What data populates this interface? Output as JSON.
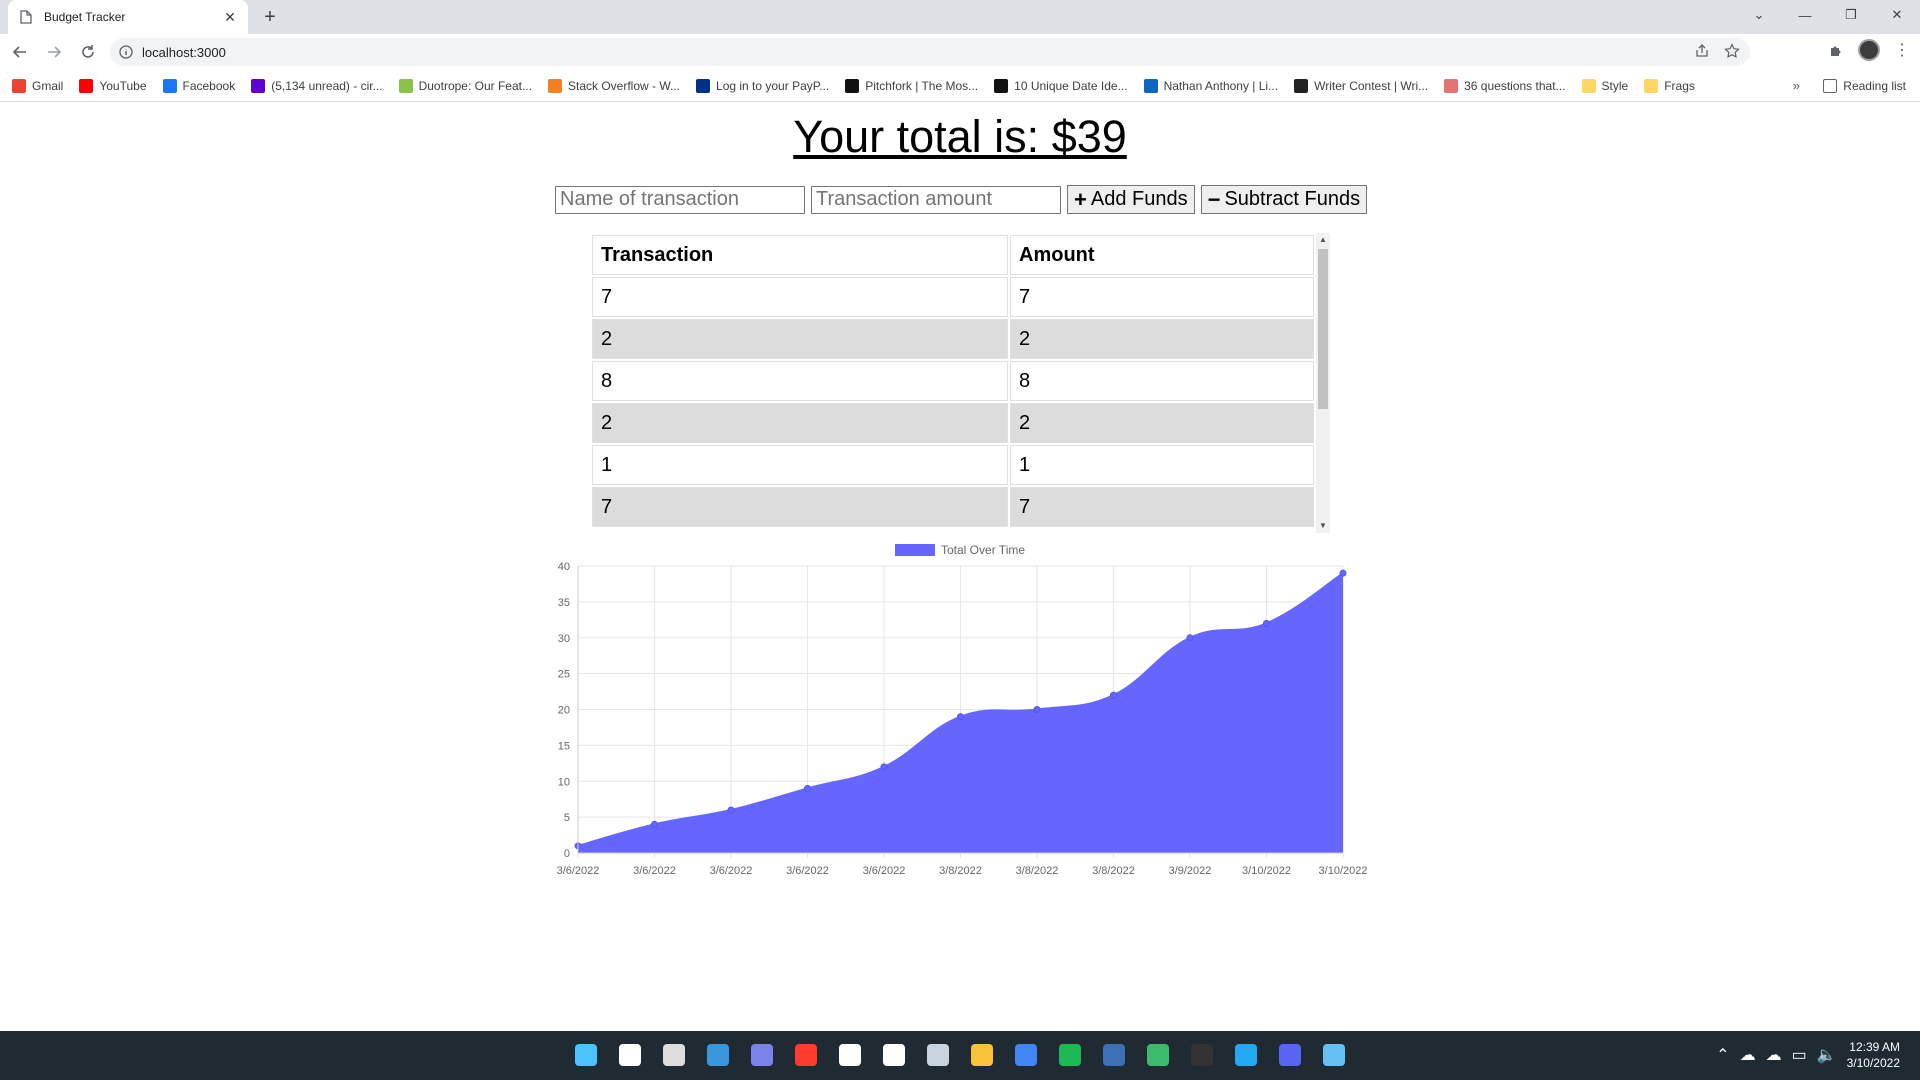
{
  "browser": {
    "tab_title": "Budget Tracker",
    "url": "localhost:3000",
    "bookmarks": [
      {
        "label": "Gmail",
        "color": "#ea4335"
      },
      {
        "label": "YouTube",
        "color": "#ff0000"
      },
      {
        "label": "Facebook",
        "color": "#1877f2"
      },
      {
        "label": "(5,134 unread) - cir...",
        "color": "#6001d2"
      },
      {
        "label": "Duotrope: Our Feat...",
        "color": "#8bc34a"
      },
      {
        "label": "Stack Overflow - W...",
        "color": "#f48024"
      },
      {
        "label": "Log in to your PayP...",
        "color": "#003087"
      },
      {
        "label": "Pitchfork | The Mos...",
        "color": "#111111"
      },
      {
        "label": "10 Unique Date Ide...",
        "color": "#111111"
      },
      {
        "label": "Nathan Anthony | Li...",
        "color": "#0a66c2"
      },
      {
        "label": "Writer Contest | Wri...",
        "color": "#222222"
      },
      {
        "label": "36 questions that...",
        "color": "#e57373"
      },
      {
        "label": "Style",
        "color": "#fdd663"
      },
      {
        "label": "Frags",
        "color": "#fdd663"
      }
    ],
    "more": "»",
    "reading_list": "Reading list"
  },
  "page": {
    "total_text": "Your total is: $39",
    "name_placeholder": "Name of transaction",
    "amount_placeholder": "Transaction amount",
    "add_label": "Add Funds",
    "subtract_label": "Subtract Funds",
    "add_symbol": "+",
    "subtract_symbol": "−",
    "table": {
      "headers": [
        "Transaction",
        "Amount"
      ],
      "rows": [
        [
          "7",
          "7"
        ],
        [
          "2",
          "2"
        ],
        [
          "8",
          "8"
        ],
        [
          "2",
          "2"
        ],
        [
          "1",
          "1"
        ],
        [
          "7",
          "7"
        ]
      ]
    }
  },
  "chart_data": {
    "type": "area",
    "x": [
      "3/6/2022",
      "3/6/2022",
      "3/6/2022",
      "3/6/2022",
      "3/6/2022",
      "3/8/2022",
      "3/8/2022",
      "3/8/2022",
      "3/9/2022",
      "3/10/2022",
      "3/10/2022"
    ],
    "series": [
      {
        "name": "Total Over Time",
        "values": [
          1,
          4,
          6,
          9,
          12,
          19,
          20,
          22,
          30,
          32,
          39
        ],
        "color": "#6666ff"
      }
    ],
    "ylim": [
      0,
      40
    ],
    "yticks": [
      0,
      5,
      10,
      15,
      20,
      25,
      30,
      35,
      40
    ],
    "grid": true,
    "legend": "top"
  },
  "taskbar": {
    "time": "12:39 AM",
    "date": "3/10/2022",
    "apps": [
      {
        "name": "windows-start-icon",
        "color": "#4cc2ff"
      },
      {
        "name": "search-icon",
        "color": "#ffffff"
      },
      {
        "name": "task-view-icon",
        "color": "#dddddd"
      },
      {
        "name": "widgets-icon",
        "color": "#3a96dd"
      },
      {
        "name": "teams-chat-icon",
        "color": "#7b83eb"
      },
      {
        "name": "red-diamond-app-icon",
        "color": "#ff3b30"
      },
      {
        "name": "dropbox-icon",
        "color": "#ffffff"
      },
      {
        "name": "bolt-app-icon",
        "color": "#ffffff"
      },
      {
        "name": "steam-icon",
        "color": "#c7d5e0"
      },
      {
        "name": "file-explorer-icon",
        "color": "#f8c33a"
      },
      {
        "name": "chrome-icon",
        "color": "#4285f4"
      },
      {
        "name": "spotify-icon",
        "color": "#1db954"
      },
      {
        "name": "notepad-icon",
        "color": "#3b6fb6"
      },
      {
        "name": "leaf-app-icon",
        "color": "#3dbb6c"
      },
      {
        "name": "terminal-icon",
        "color": "#333333"
      },
      {
        "name": "vscode-icon",
        "color": "#23a9f2"
      },
      {
        "name": "discord-icon",
        "color": "#5865f2"
      },
      {
        "name": "steam-icon-2",
        "color": "#66c0f4"
      }
    ]
  }
}
